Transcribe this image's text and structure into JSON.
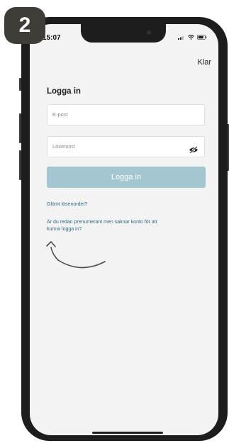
{
  "step_badge": "2",
  "status_bar": {
    "time": "15:07"
  },
  "nav": {
    "done_label": "Klar"
  },
  "login": {
    "title": "Logga in",
    "email_placeholder": "E-post",
    "password_placeholder": "Lösenord",
    "submit_label": "Logga in",
    "forgot_password_link": "Glömt lösenordet?",
    "subscriber_link_line1": "Är du redan prenumerant men saknar konto för att",
    "subscriber_link_line2": "kunna logga in?"
  },
  "colors": {
    "button": "#a3c6d0",
    "link": "#2f6b84",
    "badge": "#3f3d38",
    "screen_bg": "#f3f3f3"
  },
  "icons": [
    "eye-off-icon",
    "signal-icon",
    "wifi-icon",
    "battery-icon",
    "curved-arrow-icon"
  ]
}
